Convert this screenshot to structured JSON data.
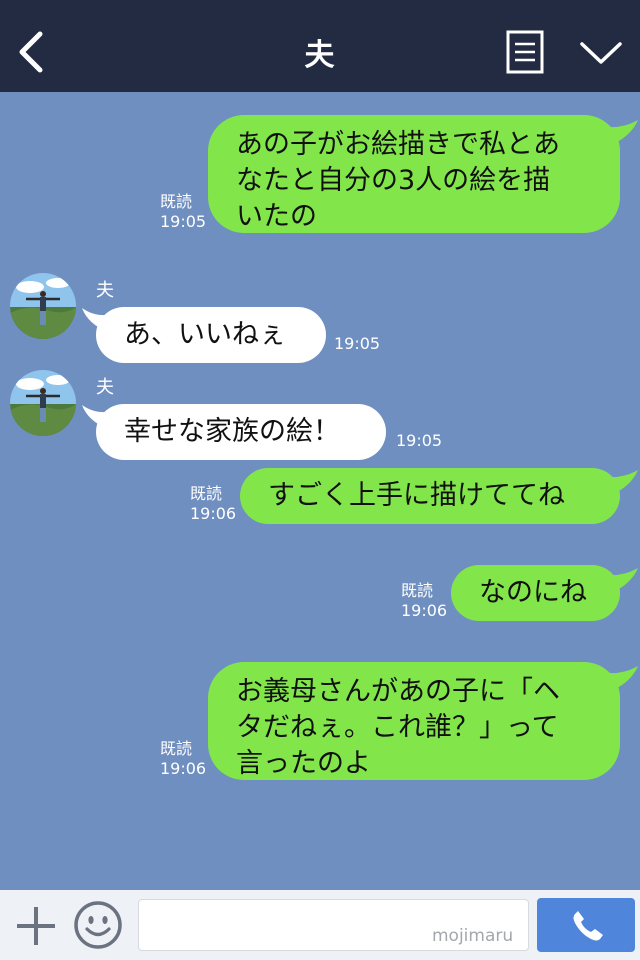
{
  "header": {
    "title": "夫"
  },
  "messages": [
    {
      "side": "sent",
      "lines": [
        "あの子がお絵描きで私とあ",
        "なたと自分の3人の絵を描",
        "いたの"
      ],
      "read": "既読",
      "time": "19:05"
    },
    {
      "side": "recv",
      "sender": "夫",
      "text": "あ、いいねぇ",
      "time": "19:05"
    },
    {
      "side": "recv",
      "sender": "夫",
      "text": "幸せな家族の絵！",
      "time": "19:05"
    },
    {
      "side": "sent",
      "text": "すごく上手に描けててね",
      "read": "既読",
      "time": "19:06"
    },
    {
      "side": "sent",
      "text": "なのにね",
      "read": "既読",
      "time": "19:06"
    },
    {
      "side": "sent",
      "lines": [
        "お義母さんがあの子に「ヘ",
        "タだねぇ。これ誰？」って",
        "言ったのよ"
      ],
      "read": "既読",
      "time": "19:06"
    }
  ],
  "input": {
    "value": "",
    "placeholder": ""
  },
  "watermark": "mojimaru",
  "colors": {
    "header_bg": "#232b42",
    "chat_bg": "#6f8fc0",
    "sent_bubble": "#82e64b",
    "recv_bubble": "#ffffff",
    "call_button": "#4f86db"
  },
  "icons": [
    "back-arrow-icon",
    "notes-icon",
    "chevron-down-icon",
    "plus-icon",
    "emoji-icon",
    "phone-icon"
  ]
}
